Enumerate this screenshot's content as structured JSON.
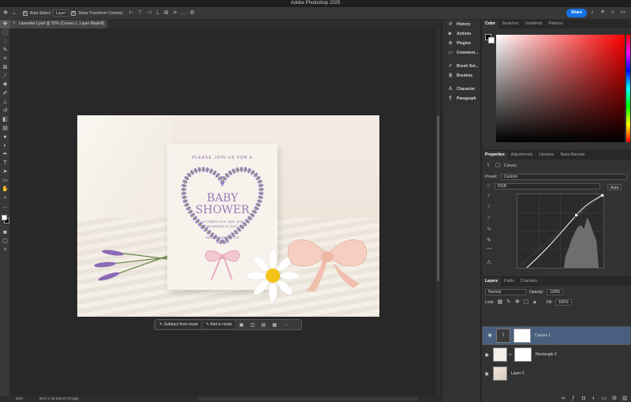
{
  "app": {
    "title": "Adobe Photoshop 2025"
  },
  "options": {
    "auto_select_label": "Auto-Select",
    "auto_select_checked": true,
    "target_value": "Layer",
    "show_transform_label": "Show Transform Controls",
    "share_label": "Share"
  },
  "document": {
    "tab_title": "Lavender1.psd @ 25% (Curves 1, Layer Mask/8)"
  },
  "card": {
    "line1": "PLEASE JOIN US FOR A",
    "line2a": "BABY",
    "line2b": "SHOWER",
    "line3": "OCTOBER 14TH, 2022, 4PM",
    "line4": "123 ANYWHERE ST, ANY CITY",
    "line5": "RSVP TO JANE AT 123",
    "line6": "456 7890"
  },
  "context_bar": {
    "subtract_label": "Subtract from mask",
    "add_label": "Add to mask"
  },
  "status": {
    "zoom": "25%",
    "dims": "50 in x 33.333 in (72 ppi)"
  },
  "mid_panels": [
    {
      "label": "History",
      "icon": "history-icon"
    },
    {
      "label": "Actions",
      "icon": "actions-icon"
    },
    {
      "label": "Plugins",
      "icon": "plugins-icon"
    },
    {
      "label": "Comment...",
      "icon": "comment-icon"
    },
    {
      "label": "Brush Set...",
      "icon": "brush-settings-icon"
    },
    {
      "label": "Brushes",
      "icon": "brushes-icon"
    },
    {
      "label": "Character",
      "icon": "character-icon"
    },
    {
      "label": "Paragraph",
      "icon": "paragraph-icon"
    }
  ],
  "color_tabs": [
    "Color",
    "Swatches",
    "Gradients",
    "Patterns"
  ],
  "properties": {
    "tabs": [
      "Properties",
      "Adjustments",
      "Libraries",
      "Nano-Banana"
    ],
    "type_label": "Curves",
    "preset_label": "Preset:",
    "preset_value": "Custom",
    "channel_value": "RGB",
    "auto_label": "Auto"
  },
  "layers_panel": {
    "tabs": [
      "Layers",
      "Paths",
      "Channels"
    ],
    "blend_mode": "Normal",
    "opacity_label": "Opacity:",
    "opacity_value": "100%",
    "lock_label": "Lock:",
    "fill_label": "Fill:",
    "fill_value": "100%",
    "layers": [
      {
        "name": "Curves 1",
        "selected": true
      },
      {
        "name": "Rectangle 2",
        "selected": false
      },
      {
        "name": "Layer 0",
        "selected": false
      }
    ]
  },
  "colors": {
    "accent": "#1473e6",
    "selection": "#4a5f7f"
  }
}
